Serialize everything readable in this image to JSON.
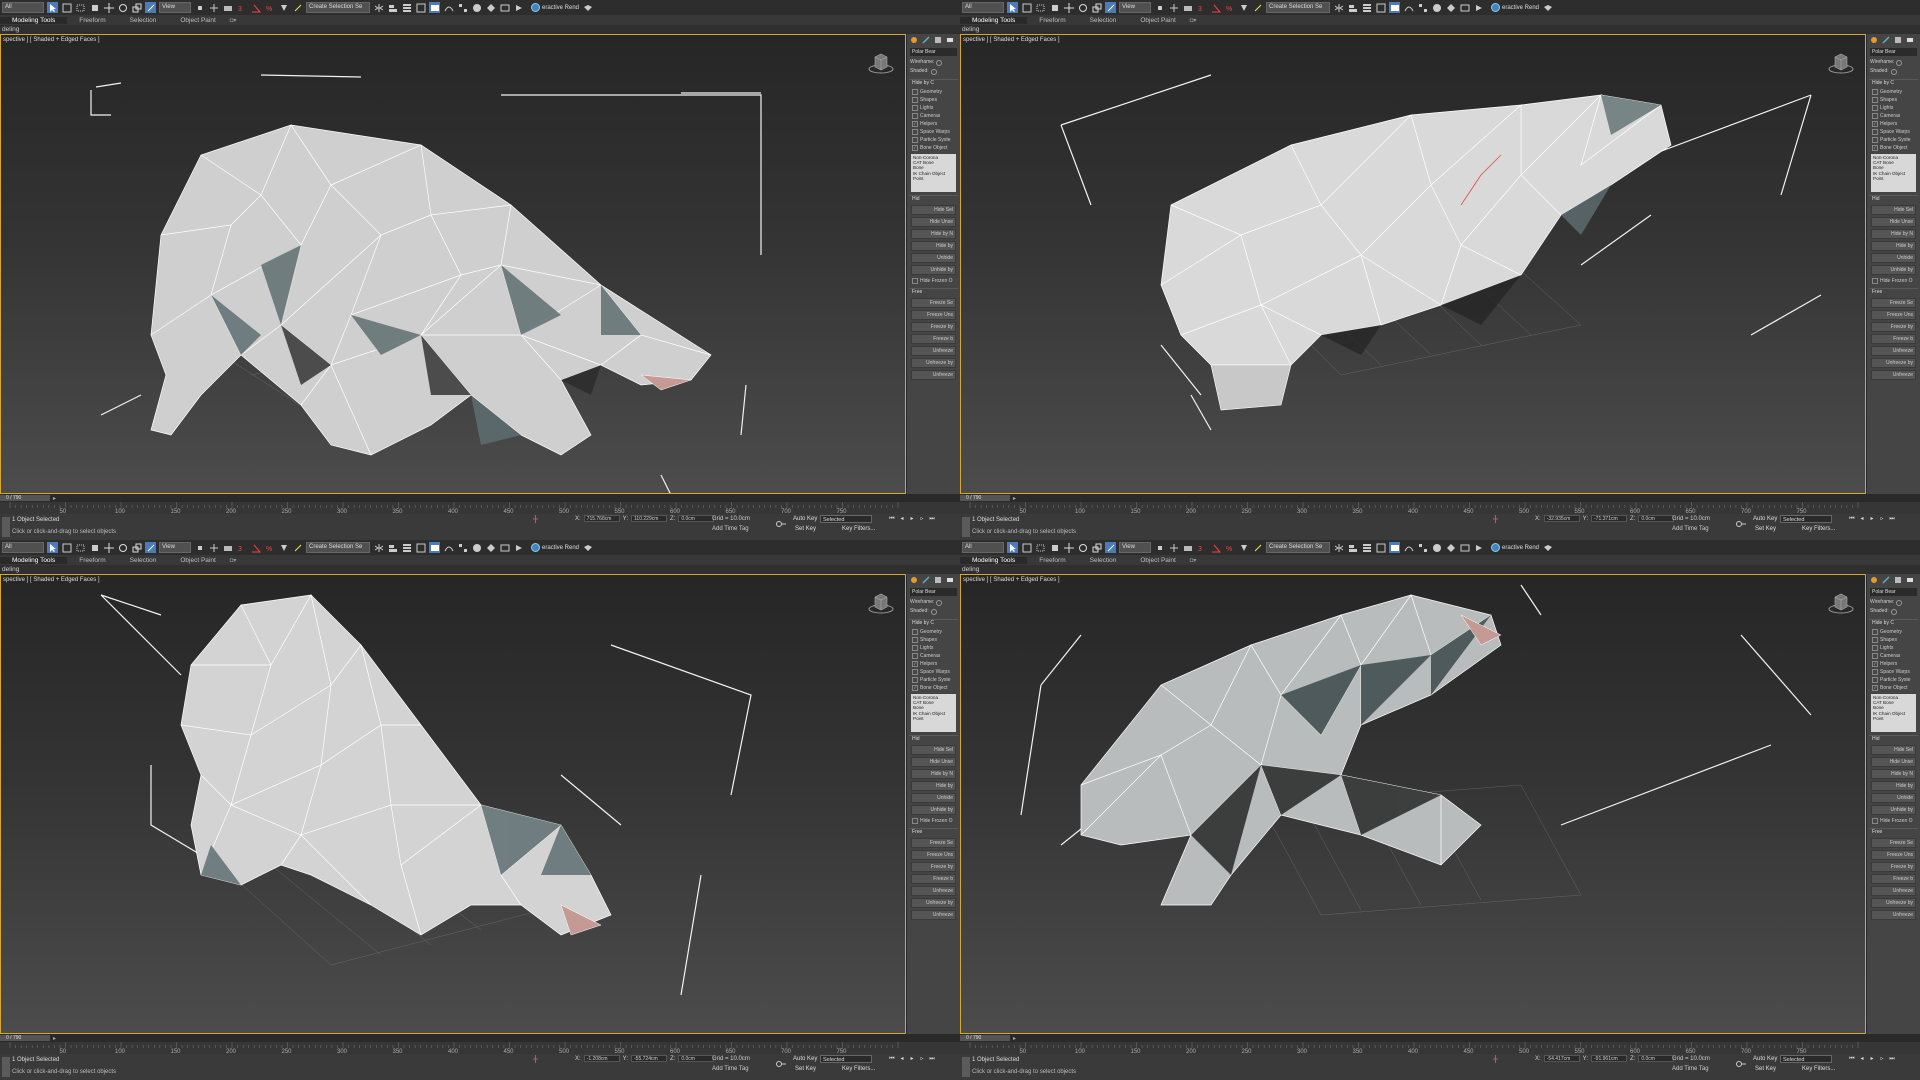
{
  "toolbar": {
    "selection_filter": "All",
    "ref_coord": "View",
    "named_selection": "Create Selection Se",
    "interactive_label": "eractive Rend"
  },
  "ribbon": {
    "tabs": [
      "Modeling Tools",
      "Freeform",
      "Selection",
      "Object Paint"
    ],
    "sub_label": "deling"
  },
  "viewport": {
    "label": "spective ] [ Shaded + Edged Faces ]"
  },
  "command_panel": {
    "object_name": "Polar Bear",
    "wireframe_label": "Wireframe:",
    "shaded_label": "Shaded:",
    "hide_by_category_title": "Hide by C",
    "categories": [
      "Geometry",
      "Shapes",
      "Lights",
      "Cameras",
      "Helpers",
      "Space Warps",
      "Particle Syste",
      "Bone Object"
    ],
    "list_items": [
      "Non-Corona",
      "CAT Bone",
      "Bone",
      "IK Chain Object",
      "Point"
    ],
    "hide_title": "Hid",
    "hide_buttons": [
      "Hide Sel",
      "Hide Unse",
      "Hide by N",
      "Hide by",
      "Unhide",
      "Unhide by"
    ],
    "hide_frozen": "Hide Frozen O",
    "freeze_title": "Free",
    "freeze_buttons": [
      "Freeze Se",
      "Freeze Uns",
      "Freeze by",
      "Freeze b",
      "Unfreeze",
      "Unfreeze by",
      "Unfreeze"
    ]
  },
  "timeline": {
    "frame_counter": "0 / 790",
    "ticks": [
      "50",
      "100",
      "150",
      "200",
      "250",
      "300",
      "350",
      "400",
      "450",
      "500",
      "550",
      "600",
      "650",
      "700",
      "750"
    ]
  },
  "status": {
    "selected": "1 Object Selected",
    "prompt": "Click or click-and-drag to select objects",
    "x_label": "X:",
    "y_label": "Y:",
    "z_label": "Z:",
    "grid": "Grid = 10.0cm",
    "add_time_tag": "Add Time Tag",
    "auto_key": "Auto Key",
    "set_key": "Set Key",
    "selected_mode": "Selected",
    "key_filters": "Key Filters..."
  },
  "quads": [
    {
      "id": "tl",
      "coords": {
        "x": "715.768cm",
        "y": "110.229cm",
        "z": "0.0cm"
      }
    },
    {
      "id": "tr",
      "coords": {
        "x": "-32.935cm",
        "y": "-71.371cm",
        "z": "0.0cm"
      }
    },
    {
      "id": "bl",
      "coords": {
        "x": "-1.208cm",
        "y": "-55.724cm",
        "z": "0.0cm"
      }
    },
    {
      "id": "br",
      "coords": {
        "x": "-54.417cm",
        "y": "-91.961cm",
        "z": "0.0cm"
      }
    }
  ],
  "colors": {
    "accent_active": "#4a7bbd",
    "viewport_border": "#d9a72b",
    "mesh_light": "#e6e6e6",
    "mesh_shadow": "#5f6f72"
  }
}
